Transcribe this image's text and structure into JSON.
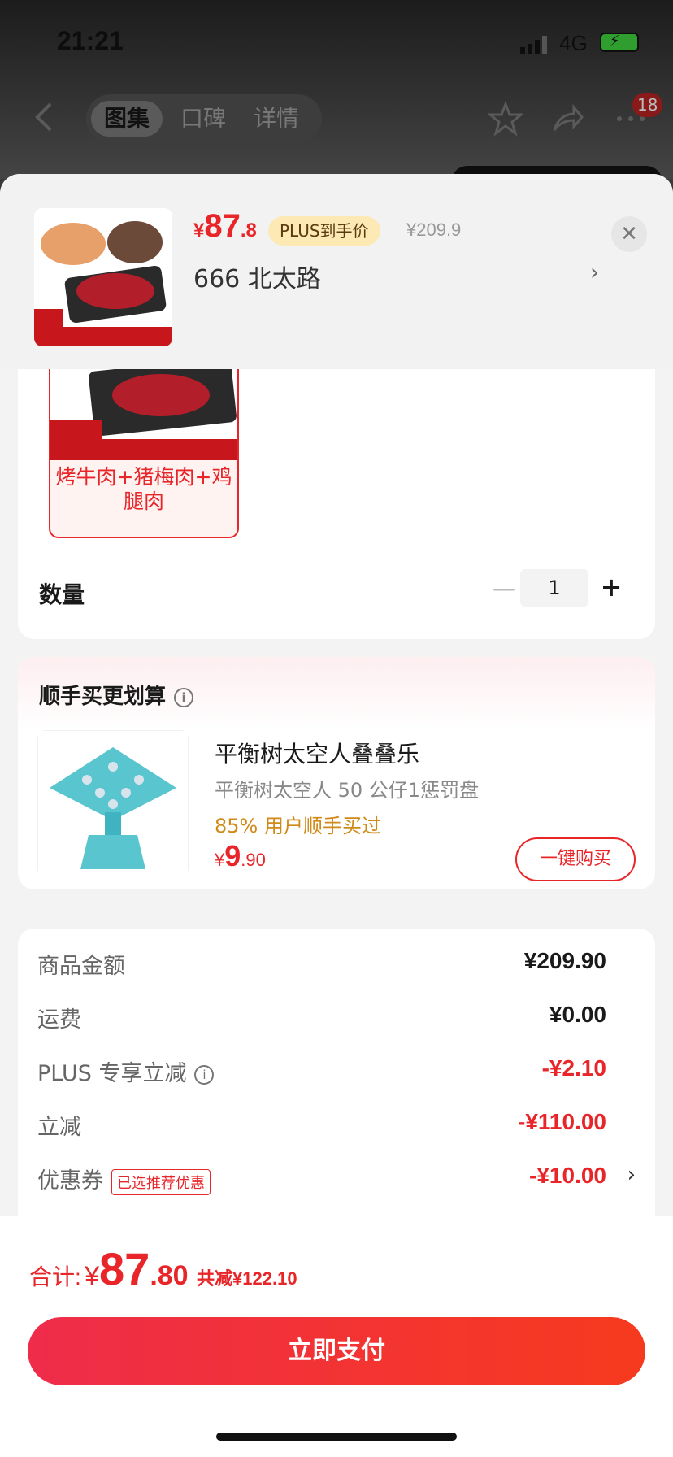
{
  "status_bar": {
    "time": "21:21",
    "network": "4G"
  },
  "nav": {
    "tabs": [
      {
        "label": "图集",
        "active": true
      },
      {
        "label": "口碑",
        "active": false
      },
      {
        "label": "详情",
        "active": false
      }
    ],
    "badge_count": "18"
  },
  "sheet": {
    "price_currency": "¥",
    "price_int": "87",
    "price_dec": ".8",
    "plus_tag": "PLUS到手价",
    "original_price": "¥209.9",
    "address": "666  北太路",
    "spec_option_label": "烤牛肉+猪梅肉+鸡腿肉",
    "quantity_label": "数量",
    "quantity_value": "1"
  },
  "addon": {
    "title": "顺手买更划算",
    "name": "平衡树太空人叠叠乐",
    "desc": "平衡树太空人 50 公仔1惩罚盘",
    "stat": "85% 用户顺手买过",
    "price_currency": "¥",
    "price_int": "9",
    "price_dec": ".90",
    "buy_label": "一键购买"
  },
  "summary": {
    "rows": [
      {
        "label": "商品金额",
        "value": "¥209.90"
      },
      {
        "label": "运费",
        "value": "¥0.00"
      },
      {
        "label": "PLUS 专享立减",
        "value": "-¥2.10"
      },
      {
        "label": "立减",
        "value": "-¥110.00"
      },
      {
        "label": "优惠券",
        "value": "-¥10.00",
        "tag": "已选推荐优惠"
      }
    ]
  },
  "footer": {
    "total_label": "合计:",
    "total_currency": "¥",
    "total_int": "87",
    "total_dec": ".80",
    "saved": "共减¥122.10",
    "pay_label": "立即支付"
  },
  "colors": {
    "accent": "#e8262a",
    "plus_tag_bg": "#fde9b4",
    "addon_stat": "#d08a1a"
  },
  "icons": [
    "back-icon",
    "star-icon",
    "share-icon",
    "more-icon",
    "close-icon",
    "info-icon",
    "chevron-right-icon",
    "minus-icon",
    "plus-icon"
  ]
}
